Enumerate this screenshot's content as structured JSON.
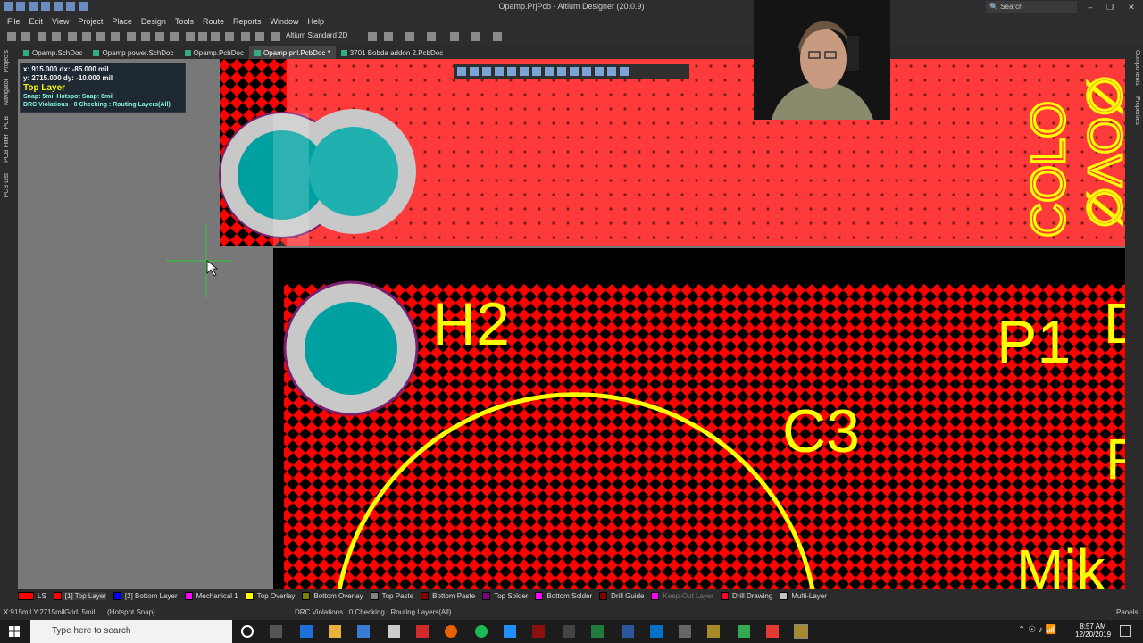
{
  "window": {
    "title": "Opamp.PrjPcb - Altium Designer (20.0.9)",
    "search_placeholder": "Search"
  },
  "menu": [
    "File",
    "Edit",
    "View",
    "Project",
    "Place",
    "Design",
    "Tools",
    "Route",
    "Reports",
    "Window",
    "Help"
  ],
  "toolbar": {
    "view_mode": "Altium Standard 2D"
  },
  "tabs": [
    {
      "label": "Opamp.SchDoc",
      "active": false
    },
    {
      "label": "Opamp power.SchDoc",
      "active": false
    },
    {
      "label": "Opamp.PcbDoc",
      "active": false
    },
    {
      "label": "Opamp pnl.PcbDoc *",
      "active": true
    },
    {
      "label": "3701 Bobda addon 2.PcbDoc",
      "active": false
    }
  ],
  "left_panels": [
    "Projects",
    "Navigator",
    "PCB",
    "PCB Filter",
    "PCB List"
  ],
  "right_panels": [
    "Components",
    "Properties"
  ],
  "hud": {
    "line1": "x:  915.000   dx:  -85.000  mil",
    "line2": "y: 2715.000   dy:  -10.000  mil",
    "layer": "Top Layer",
    "snap": "Snap: 5mil Hotspot Snap: 8mil",
    "drc": "DRC Violations : 0 Checking : Routing Layers(All)"
  },
  "pcb": {
    "silk_labels": {
      "h2": "H2",
      "p1": "P1",
      "c3": "C3",
      "mik": "Mik",
      "colo": "COLO",
      "rot": "∅ɅO∅",
      "d": "D",
      "p": "P"
    }
  },
  "layers": [
    {
      "label": "LS",
      "color": "#ff0000"
    },
    {
      "label": "[1] Top Layer",
      "color": "#ff0000",
      "active": true
    },
    {
      "label": "[2] Bottom Layer",
      "color": "#0000ff"
    },
    {
      "label": "Mechanical 1",
      "color": "#ff00ff"
    },
    {
      "label": "Top Overlay",
      "color": "#ffff00"
    },
    {
      "label": "Bottom Overlay",
      "color": "#808000"
    },
    {
      "label": "Top Paste",
      "color": "#808080"
    },
    {
      "label": "Bottom Paste",
      "color": "#800000"
    },
    {
      "label": "Top Solder",
      "color": "#800080"
    },
    {
      "label": "Bottom Solder",
      "color": "#ff00ff"
    },
    {
      "label": "Drill Guide",
      "color": "#800000"
    },
    {
      "label": "Keep-Out Layer",
      "color": "#ff00ff"
    },
    {
      "label": "Drill Drawing",
      "color": "#ff002a"
    },
    {
      "label": "Multi-Layer",
      "color": "#c0c0c0"
    }
  ],
  "status": {
    "coords": "X:915mil Y:2715mil",
    "grid": "Grid: 5mil",
    "hotspot": "(Hotspot Snap)",
    "drc": "DRC Violations : 0 Checking : Routing Layers(All)",
    "panels": "Panels"
  },
  "taskbar": {
    "search_placeholder": "Type here to search",
    "time": "8:57 AM",
    "date": "12/20/2019"
  }
}
